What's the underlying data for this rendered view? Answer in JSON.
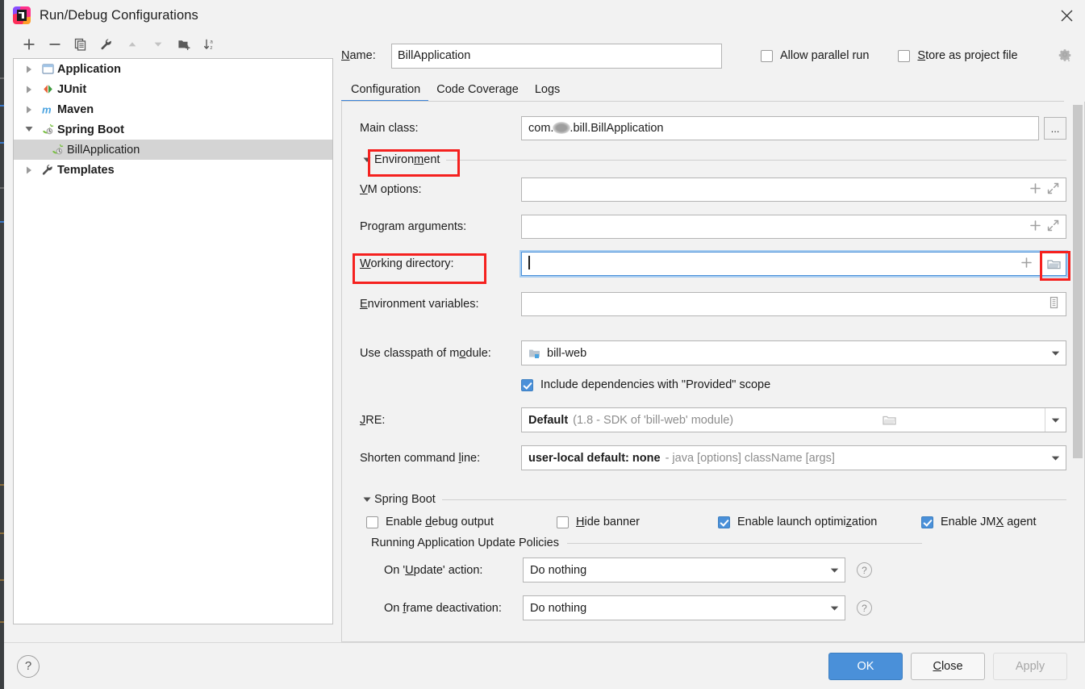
{
  "window": {
    "title": "Run/Debug Configurations",
    "app_icon": "intellij-idea-icon",
    "close_icon": "close-icon"
  },
  "tree_toolbar": {
    "buttons": [
      {
        "name": "add-configuration-button",
        "icon": "plus-icon",
        "tooltip": "Add New Configuration"
      },
      {
        "name": "remove-configuration-button",
        "icon": "minus-icon",
        "tooltip": "Remove Configuration"
      },
      {
        "name": "copy-configuration-button",
        "icon": "copy-icon",
        "tooltip": "Copy Configuration"
      },
      {
        "name": "edit-templates-button",
        "icon": "wrench-icon",
        "tooltip": "Edit Templates"
      },
      {
        "name": "move-up-button",
        "icon": "arrow-up-icon",
        "tooltip": "Move Up"
      },
      {
        "name": "move-down-button",
        "icon": "arrow-down-icon",
        "tooltip": "Move Down"
      },
      {
        "name": "new-folder-button",
        "icon": "folder-add-icon",
        "tooltip": "Create New Folder"
      },
      {
        "name": "sort-button",
        "icon": "sort-az-icon",
        "tooltip": "Sort Configurations"
      }
    ]
  },
  "tree": {
    "items": [
      {
        "label": "Application",
        "icon": "application-icon",
        "expanded": false,
        "selected": false,
        "child": false
      },
      {
        "label": "JUnit",
        "icon": "junit-icon",
        "expanded": false,
        "selected": false,
        "child": false
      },
      {
        "label": "Maven",
        "icon": "maven-icon",
        "expanded": false,
        "selected": false,
        "child": false
      },
      {
        "label": "Spring Boot",
        "icon": "spring-boot-icon",
        "expanded": true,
        "selected": false,
        "child": false
      },
      {
        "label": "BillApplication",
        "icon": "spring-boot-icon",
        "expanded": null,
        "selected": true,
        "child": true
      },
      {
        "label": "Templates",
        "icon": "wrench-icon",
        "expanded": false,
        "selected": false,
        "child": false
      }
    ]
  },
  "header": {
    "name_label": "Name:",
    "name_value": "BillApplication",
    "allow_parallel_run": {
      "label": "Allow parallel run",
      "checked": false
    },
    "store_as_project_file": {
      "label": "Store as project file",
      "checked": false
    },
    "gear_icon": "gear-dropdown-icon"
  },
  "tabs": [
    {
      "label": "Configuration",
      "active": true
    },
    {
      "label": "Code Coverage",
      "active": false
    },
    {
      "label": "Logs",
      "active": false
    }
  ],
  "configuration": {
    "main_class": {
      "label": "Main class:",
      "value_prefix": "com.",
      "value_suffix": ".bill.BillApplication",
      "redacted": true,
      "browse_button": "..."
    },
    "environment_section": {
      "title": "Environment",
      "highlighted": true,
      "vm_options": {
        "label": "VM options:",
        "value": "",
        "icons": [
          "plus-icon",
          "expand-icon"
        ]
      },
      "program_arguments": {
        "label": "Program arguments:",
        "value": "",
        "icons": [
          "plus-icon",
          "expand-icon"
        ]
      },
      "working_directory": {
        "label": "Working directory:",
        "value": "",
        "focused": true,
        "label_highlighted": true,
        "folder_button_highlighted": true,
        "icons": [
          "plus-icon",
          "folder-icon"
        ]
      },
      "environment_variables": {
        "label": "Environment variables:",
        "value": "",
        "icons": [
          "list-edit-icon"
        ]
      }
    },
    "use_classpath_of_module": {
      "label": "Use classpath of module:",
      "value": "bill-web",
      "icon": "module-icon"
    },
    "include_provided_dependencies": {
      "label": "Include dependencies with \"Provided\" scope",
      "checked": true
    },
    "jre": {
      "label": "JRE:",
      "value_bold": "Default",
      "value_dim": "(1.8 - SDK of 'bill-web' module)",
      "icons": [
        "folder-icon",
        "chevron-down-icon"
      ]
    },
    "shorten_command_line": {
      "label": "Shorten command line:",
      "value_bold": "user-local default: none",
      "value_dim": "- java [options] className [args]"
    },
    "spring_boot_section": {
      "title": "Spring Boot",
      "checkboxes": [
        {
          "label": "Enable debug output",
          "checked": false
        },
        {
          "label": "Hide banner",
          "checked": false
        },
        {
          "label": "Enable launch optimization",
          "checked": true
        },
        {
          "label": "Enable JMX agent",
          "checked": true
        }
      ],
      "update_policies": {
        "title": "Running Application Update Policies",
        "rows": [
          {
            "label": "On 'Update' action:",
            "value": "Do nothing",
            "help_icon": "help-icon"
          },
          {
            "label": "On frame deactivation:",
            "value": "Do nothing",
            "help_icon": "help-icon"
          }
        ]
      }
    }
  },
  "footer": {
    "help_icon": "help-icon",
    "ok_label": "OK",
    "close_label": "Close",
    "apply_label": "Apply",
    "apply_enabled": false
  },
  "colors": {
    "accent": "#4a90d9",
    "highlight_box": "#f5211f",
    "tab_underline": "#3b84d8",
    "selection": "#d4d4d4",
    "dialog_bg": "#f2f2f2"
  }
}
